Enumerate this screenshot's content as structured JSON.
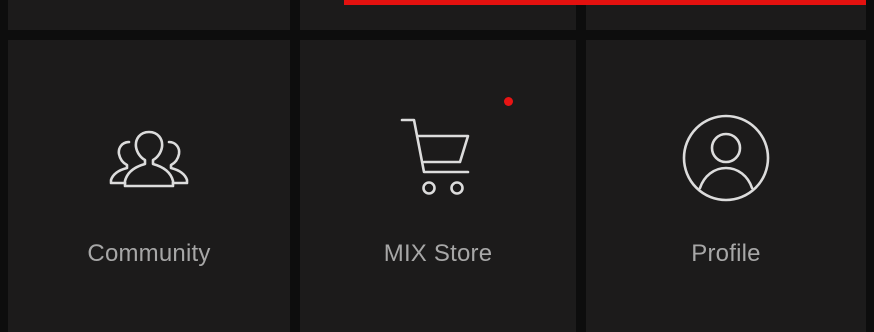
{
  "menu": {
    "tiles": [
      {
        "label": "Community",
        "icon": "community-icon"
      },
      {
        "label": "MIX Store",
        "icon": "shopping-cart-icon",
        "notification": true
      },
      {
        "label": "Profile",
        "icon": "profile-icon"
      }
    ]
  },
  "colors": {
    "background": "#0d0d0d",
    "tile": "#1c1b1b",
    "label": "#a7a7a7",
    "icon": "#dcdcdc",
    "accent_red": "#e3110f",
    "notification_dot": "#e81414"
  }
}
